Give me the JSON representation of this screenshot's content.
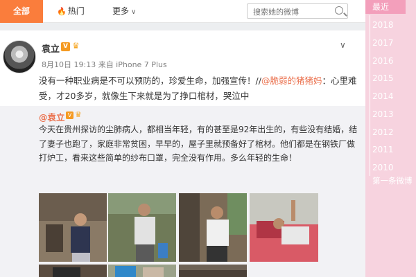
{
  "tabs": {
    "all": "全部",
    "hot": "热门",
    "more": "更多"
  },
  "search": {
    "placeholder": "搜索她的微博"
  },
  "post": {
    "username": "袁立",
    "verified_badge": "V",
    "meta": "8月10日 19:13 来自 iPhone 7 Plus",
    "text_prefix": "没有一种职业病是不可以预防的，珍爱生命，加强宣传！//",
    "mention": "@脆弱的猪猪妈",
    "text_suffix": "：心里难受，才20多岁，就像生下来就是为了挣口棺材，哭泣中"
  },
  "repost": {
    "username": "@袁立",
    "verified_badge": "V",
    "text": "今天在贵州探访的尘肺病人，都相当年轻，有的甚至是92年出生的，有些没有结婚，结了妻子也跑了，家庭非常贫困，早早的，屋子里就预备好了棺材。他们都是在钢铁厂做打炉工，看来这些简单的纱布口罩，完全没有作用。多么年轻的生命！"
  },
  "sidebar": {
    "current": "最近",
    "years": [
      "2018",
      "2017",
      "2016",
      "2015",
      "2014",
      "2013",
      "2012",
      "2011",
      "2010"
    ],
    "first_post": "第一条微博"
  },
  "colors": {
    "accent": "#fa7d3c",
    "link": "#eb7350",
    "sidebar": "#f7d3df"
  },
  "icons": {
    "hot": "fire-icon",
    "more": "chevron-down-icon",
    "search": "search-icon",
    "caret": "chevron-down-icon",
    "badge": "verified-v-icon",
    "crown": "crown-icon"
  }
}
